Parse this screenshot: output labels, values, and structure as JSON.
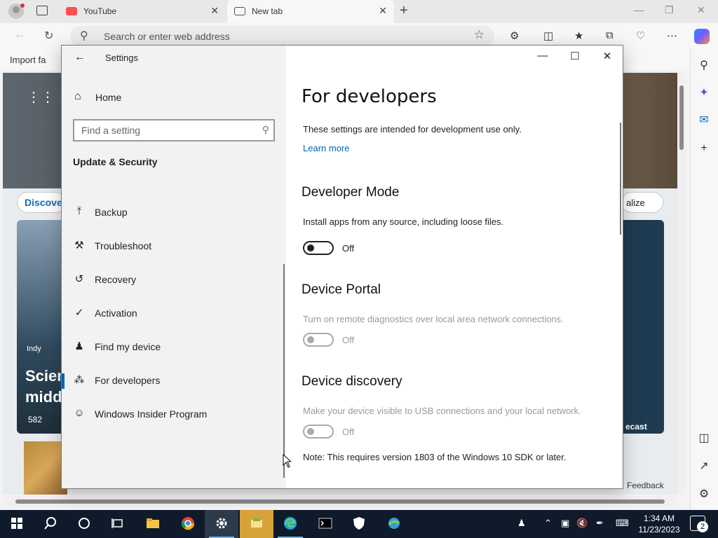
{
  "browser": {
    "tabs": [
      {
        "title": "YouTube",
        "close": "✕"
      },
      {
        "title": "New tab",
        "close": "✕"
      }
    ],
    "new_tab_glyph": "+",
    "address_placeholder": "Search or enter web address",
    "favorites_bar_item": "Import fa",
    "page": {
      "discover": "Discover",
      "personalize": "alize",
      "story_source": "Indy",
      "story_headline_1": "Scien",
      "story_headline_2": "midd",
      "story_likes": "582",
      "right_caption": "ecast",
      "feedback": "Feedback"
    }
  },
  "settings": {
    "window_title": "Settings",
    "home_label": "Home",
    "search_placeholder": "Find a setting",
    "section_title": "Update & Security",
    "nav_items": [
      {
        "label": "Backup",
        "icon": "backup-arrow-icon"
      },
      {
        "label": "Troubleshoot",
        "icon": "wrench-icon"
      },
      {
        "label": "Recovery",
        "icon": "recovery-icon"
      },
      {
        "label": "Activation",
        "icon": "check-circle-icon"
      },
      {
        "label": "Find my device",
        "icon": "person-pin-icon"
      },
      {
        "label": "For developers",
        "icon": "developer-tools-icon",
        "active": true
      },
      {
        "label": "Windows Insider Program",
        "icon": "insider-cat-icon"
      }
    ],
    "page_title": "For developers",
    "intro": "These settings are intended for development use only.",
    "learn_more": "Learn more",
    "developer_mode": {
      "heading": "Developer Mode",
      "description": "Install apps from any source, including loose files.",
      "state": "Off"
    },
    "device_portal": {
      "heading": "Device Portal",
      "description": "Turn on remote diagnostics over local area network connections.",
      "state": "Off"
    },
    "device_discovery": {
      "heading": "Device discovery",
      "description": "Make your device visible to USB connections and your local network.",
      "state": "Off",
      "note": "Note: This requires version 1803 of the Windows 10 SDK or later."
    }
  },
  "taskbar": {
    "time": "1:34 AM",
    "date": "11/23/2023",
    "notification_count": "2",
    "accent_color": "#76b9ed"
  }
}
